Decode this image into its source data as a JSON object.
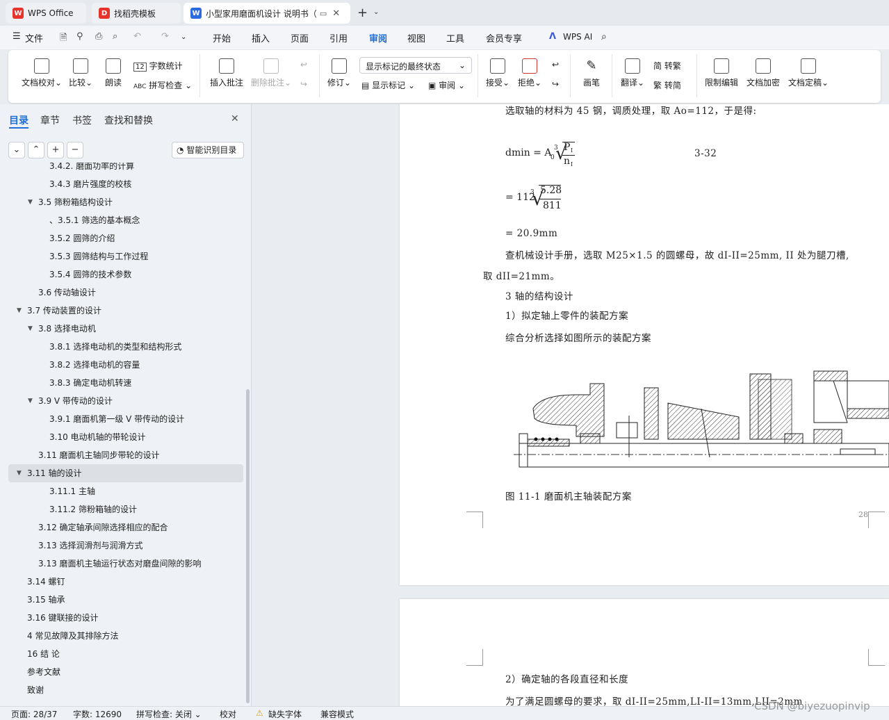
{
  "tabs": [
    {
      "label": "WPS Office"
    },
    {
      "label": "找稻壳模板"
    },
    {
      "label": "小型家用磨面机设计 说明书（"
    }
  ],
  "menu": {
    "file": "文件",
    "items": [
      "开始",
      "插入",
      "页面",
      "引用",
      "审阅",
      "视图",
      "工具",
      "会员专享"
    ],
    "active": "审阅",
    "ai": "WPS AI"
  },
  "ribbon": {
    "doc_check": "文档校对",
    "compare": "比较",
    "read": "朗读",
    "word_count": "字数统计",
    "spell_check": "拼写检查",
    "insert_comment": "插入批注",
    "delete_comment": "删除批注",
    "revise": "修订",
    "markup_state": "显示标记的最终状态",
    "show_markup": "显示标记",
    "review": "审阅",
    "accept": "接受",
    "reject": "拒绝",
    "pen": "画笔",
    "translate": "翻译",
    "to_traditional": "转繁",
    "to_simplified": "转简",
    "restrict": "限制编辑",
    "encrypt": "文档加密",
    "finalize": "文档定稿"
  },
  "sidebar": {
    "tabs": [
      "目录",
      "章节",
      "书签",
      "查找和替换"
    ],
    "smart_toc": "智能识别目录",
    "toc": [
      {
        "label": "3.4.2. 磨面功率的计算",
        "level": 3
      },
      {
        "label": "3.4.3 磨片强度的校核",
        "level": 3
      },
      {
        "label": "3.5  筛粉箱结构设计",
        "level": 2,
        "toggle": true
      },
      {
        "label": "、3.5.1  筛选的基本概念",
        "level": 3
      },
      {
        "label": "3.5.2 圆筛的介绍",
        "level": 3
      },
      {
        "label": "3.5.3  圆筛结构与工作过程",
        "level": 3
      },
      {
        "label": "3.5.4  圆筛的技术参数",
        "level": 3
      },
      {
        "label": "3.6  传动轴设计",
        "level": 2
      },
      {
        "label": "3.7  传动装置的设计",
        "level": 1,
        "toggle": true
      },
      {
        "label": "3.8  选择电动机",
        "level": 2,
        "toggle": true
      },
      {
        "label": "3.8.1  选择电动机的类型和结构形式",
        "level": 3
      },
      {
        "label": "3.8.2  选择电动机的容量",
        "level": 3
      },
      {
        "label": "3.8.3  确定电动机转速",
        "level": 3
      },
      {
        "label": "3.9 V 带传动的设计",
        "level": 2,
        "toggle": true
      },
      {
        "label": "3.9.1  磨面机第一级 V 带传动的设计",
        "level": 3
      },
      {
        "label": "3.10 电动机轴的带轮设计",
        "level": 3
      },
      {
        "label": "3.11  磨面机主轴同步带轮的设计",
        "level": 2
      },
      {
        "label": "3.11  轴的设计",
        "level": 1,
        "toggle": true,
        "selected": true
      },
      {
        "label": "3.11.1  主轴",
        "level": 3
      },
      {
        "label": "3.11.2  筛粉箱轴的设计",
        "level": 3
      },
      {
        "label": "3.12  确定轴承间隙选择相应的配合",
        "level": 2
      },
      {
        "label": "3.13 选择润滑剂与润滑方式",
        "level": 2
      },
      {
        "label": "3.13  磨面机主轴运行状态对磨盘间隙的影响",
        "level": 2
      },
      {
        "label": "3.14  螺钉",
        "level": 1
      },
      {
        "label": "3.15 轴承",
        "level": 1
      },
      {
        "label": "3.16    键联接的设计",
        "level": 1
      },
      {
        "label": "4  常见故障及其排除方法",
        "level": 1
      },
      {
        "label": "16 结  论",
        "level": 1
      },
      {
        "label": "参考文献",
        "level": 1
      },
      {
        "label": "致谢",
        "level": 1
      }
    ]
  },
  "doc": {
    "line1": "选取轴的材料为 45 钢，调质处理，取 Ao=112，于是得:",
    "formula1_lhs": "dmin  = A",
    "formula1_sub": "0",
    "formula1_root": "3",
    "formula1_num": "P",
    "formula1_num_sub": "I",
    "formula1_den": "n",
    "formula1_den_sub": "I",
    "formula1_eqno": "3-32",
    "formula2_lhs": "= 112",
    "formula2_root": "3",
    "formula2_num": "5.28",
    "formula2_den": "811",
    "result": "=  20.9mm",
    "para1": "查机械设计手册，选取 M25×1.5 的圆螺母，故 dI-II=25mm, II 处为腿刀槽,",
    "para1b": "取 dII=21mm。",
    "heading3": "3  轴的结构设计",
    "sub1": "1）拟定轴上零件的装配方案",
    "sub1text": "综合分析选择如图所示的装配方案",
    "caption": "图 11-1    磨面机主轴装配方案",
    "page_no": "28",
    "sub2": "2）确定轴的各段直径和长度",
    "sub2text": "为了满足圆螺母的要求，取 dI-II=25mm,LI-II=13mm,LII=2mm"
  },
  "status": {
    "page": "页面: 28/37",
    "words": "字数: 12690",
    "spell": "拼写检查: 关闭",
    "proof": "校对",
    "missing_font": "缺失字体",
    "compat": "兼容模式",
    "watermark": "CSDN @biyezuopinvip"
  }
}
